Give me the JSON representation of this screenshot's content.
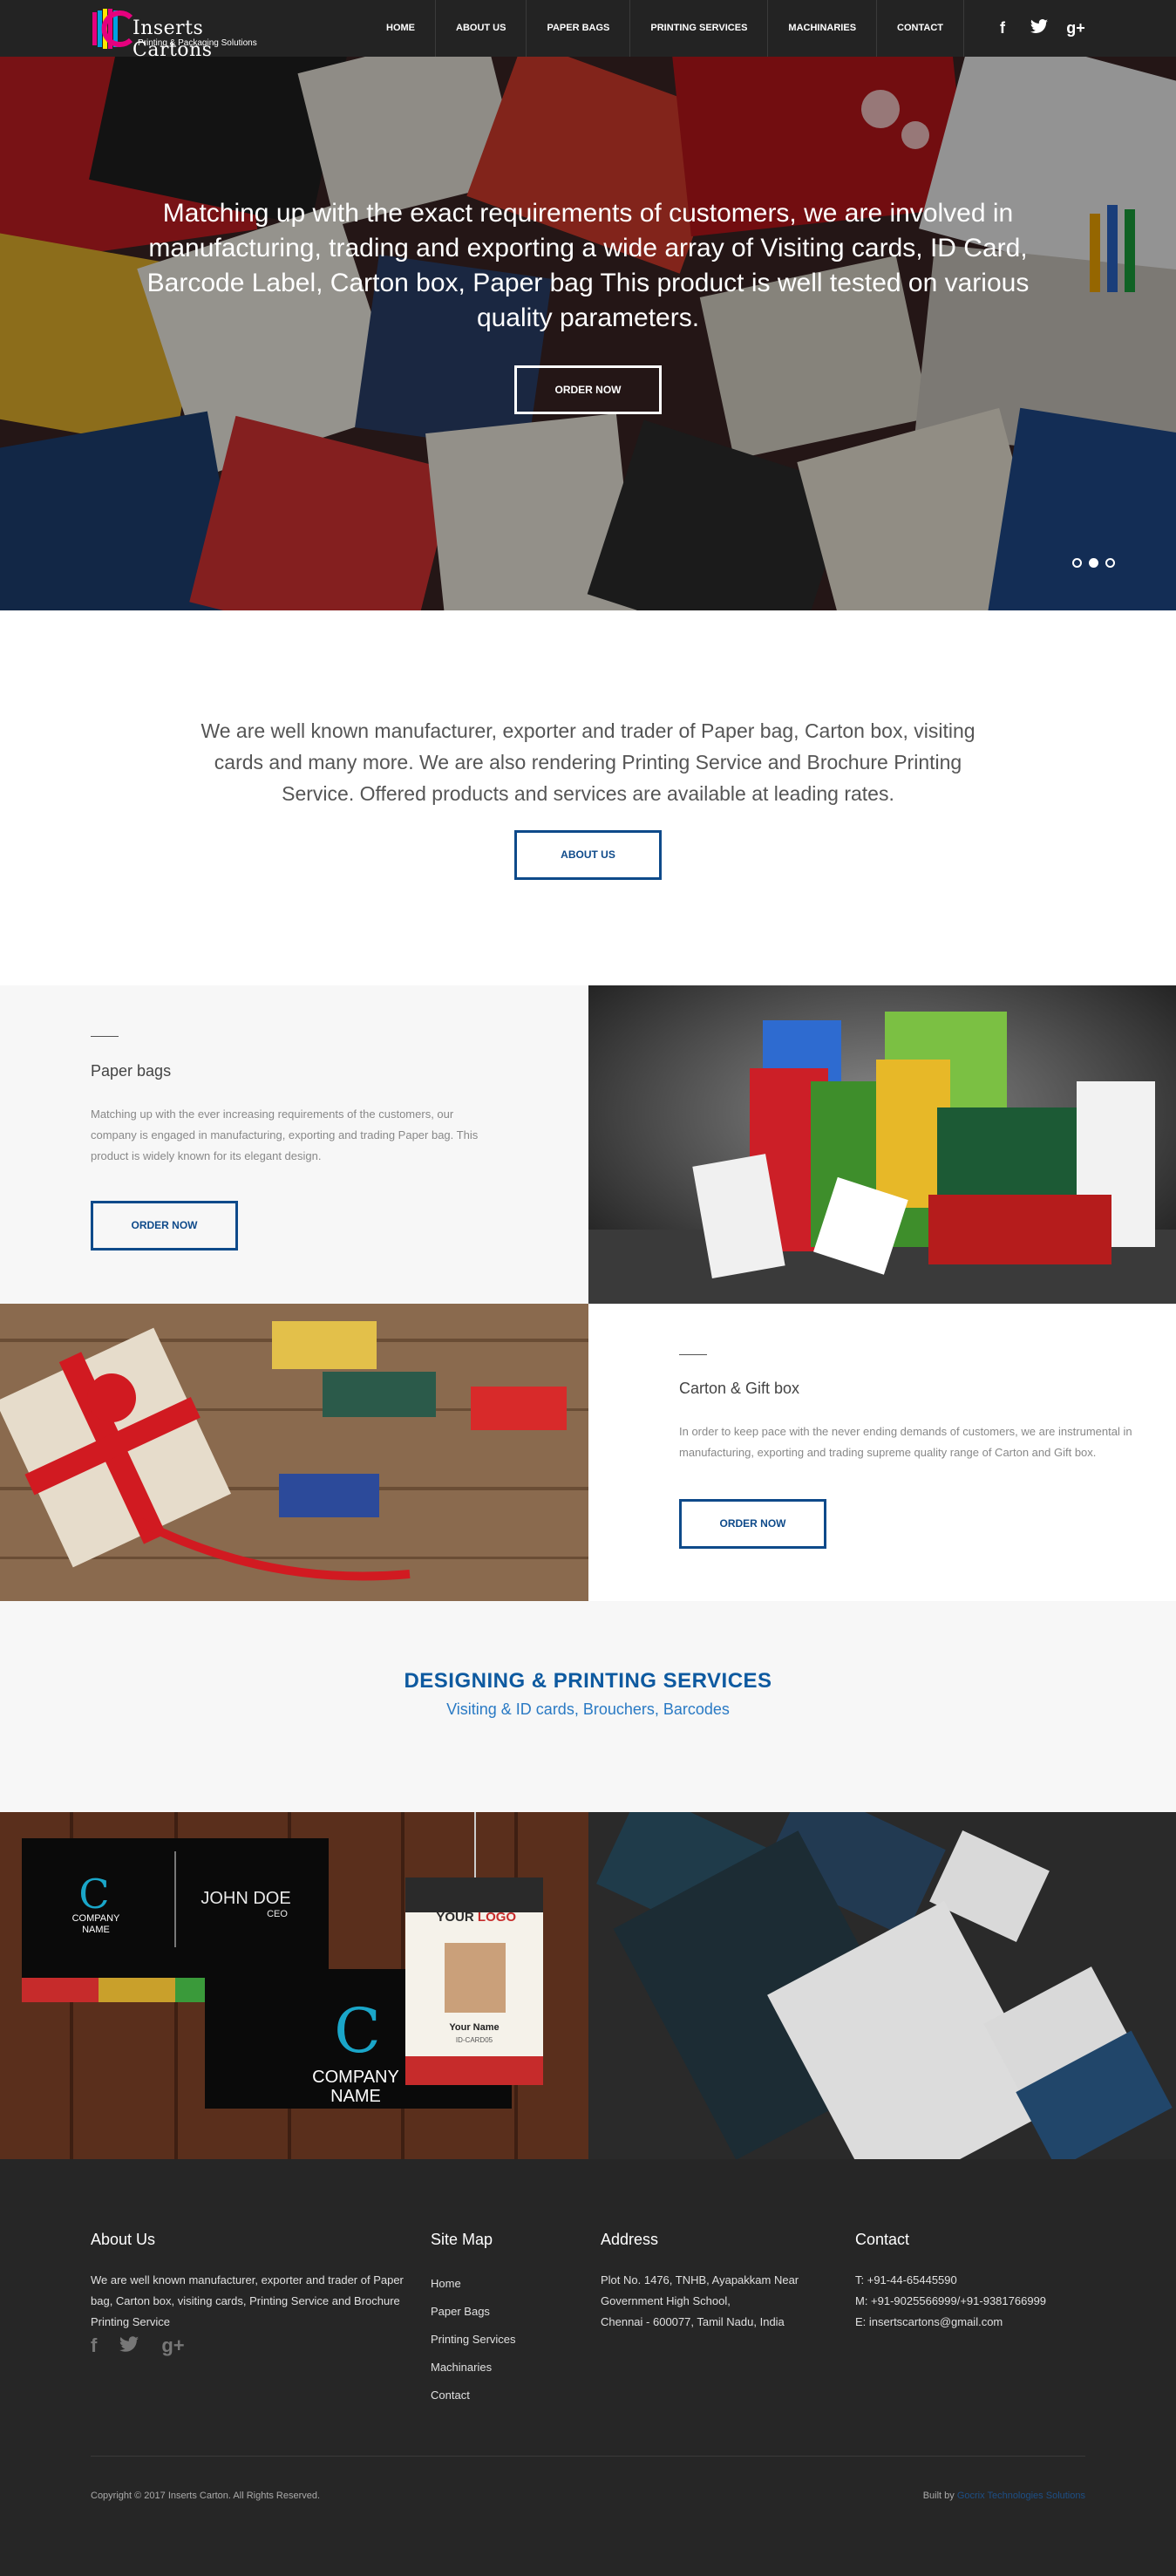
{
  "nav": {
    "logo": {
      "title": "Inserts Cartons",
      "subtitle": "Printing & Packaging Solutions"
    },
    "items": [
      "HOME",
      "ABOUT US",
      "PAPER BAGS",
      "PRINTING SERVICES",
      "MACHINARIES",
      "CONTACT"
    ],
    "social_icons": [
      "facebook-icon",
      "twitter-icon",
      "google-plus-icon"
    ]
  },
  "hero": {
    "text": "Matching up with the exact requirements of customers, we are involved in manufacturing, trading and exporting a wide array of Visiting cards, ID Card, Barcode Label, Carton box, Paper bag This product is well tested on various quality parameters.",
    "button": "ORDER NOW",
    "slides": 3,
    "active_slide": 2
  },
  "intro": {
    "text": "We are well known manufacturer, exporter and trader of Paper bag, Carton box, visiting cards and many more. We are also rendering Printing Service and Brochure Printing Service. Offered products and services are available at leading rates.",
    "button": "ABOUT US"
  },
  "products": [
    {
      "title": "Paper bags",
      "description": "Matching up with the ever increasing requirements of the customers, our company is engaged in manufacturing, exporting and trading Paper bag. This product is widely known for its elegant design.",
      "button": "ORDER NOW"
    },
    {
      "title": "Carton & Gift box",
      "description": "In order to keep pace with the never ending demands of customers, we are instrumental in manufacturing, exporting and trading supreme quality range of Carton and Gift box.",
      "button": "ORDER NOW"
    }
  ],
  "services": {
    "title": "DESIGNING & PRINTING SERVICES",
    "subtitle": "Visiting & ID cards, Brouchers, Barcodes"
  },
  "gallery": {
    "card": {
      "company": "COMPANY",
      "name_line": "NAME",
      "person": "JOHN DOE",
      "role": "CEO"
    },
    "id_card": {
      "logo_a": "YOUR",
      "logo_b": "LOGO",
      "name": "Your Name",
      "id": "ID-CARD05"
    }
  },
  "footer": {
    "about": {
      "heading": "About Us",
      "text": "We are well known manufacturer, exporter and trader of Paper bag, Carton box, visiting cards, Printing Service and Brochure Printing Service"
    },
    "sitemap": {
      "heading": "Site Map",
      "links": [
        "Home",
        "Paper Bags",
        "Printing Services",
        "Machinaries",
        "Contact"
      ]
    },
    "address": {
      "heading": "Address",
      "lines": [
        "Plot No. 1476, TNHB, Ayapakkam Near",
        "Government High School,",
        "Chennai - 600077, Tamil Nadu, India"
      ]
    },
    "contact": {
      "heading": "Contact",
      "lines": [
        "T: +91-44-65445590",
        "M: +91-9025566999/+91-9381766999",
        "E: insertscartons@gmail.com"
      ]
    },
    "copyright": "Copyright © 2017 Inserts Carton. All Rights Reserved.",
    "built_by_label": "Built by",
    "built_by_link": "Gocrix Technologies Solutions"
  }
}
